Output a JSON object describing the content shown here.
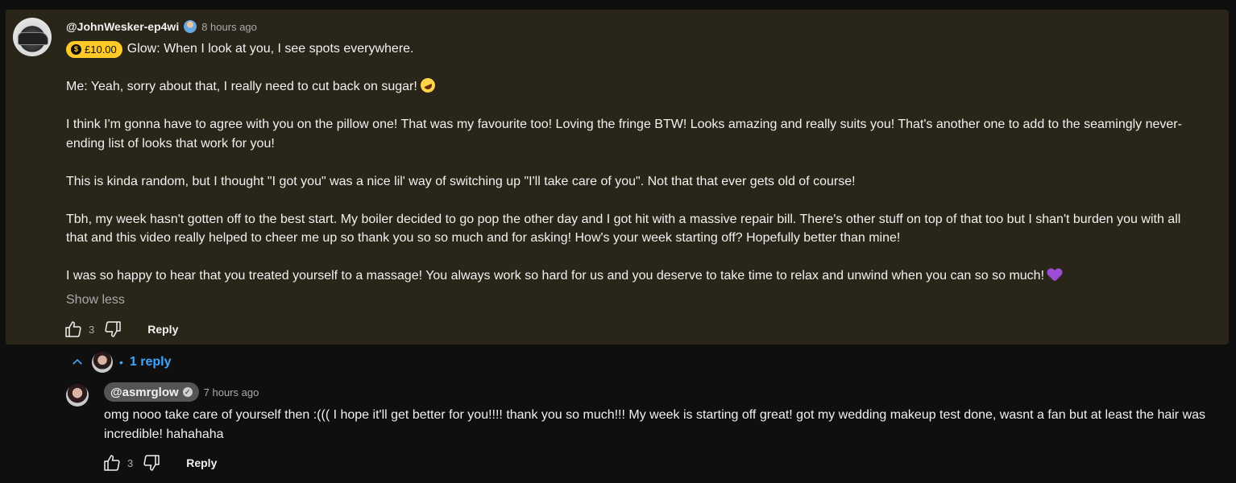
{
  "comment": {
    "author": "@JohnWesker-ep4wi",
    "member_badge_icon": "member-badge-icon",
    "time": "8 hours ago",
    "superthanks_amount": "£10.00",
    "paragraphs": [
      "Glow: When I look at you, I see spots everywhere.",
      "Me: Yeah, sorry about that, I really need to cut back on sugar!",
      "I think I'm gonna have to agree with you on the pillow one! That was my favourite too! Loving the fringe BTW! Looks amazing and really suits you! That's another one to add to the seamingly never-ending list of looks that work for you!",
      "This is kinda random, but I thought \"I got you\" was a nice lil' way of switching up \"I'll take care of you\". Not that that ever gets old of course!",
      "Tbh, my week hasn't gotten off to the best start. My boiler decided to go pop the other day and I got hit with a massive repair bill. There's other stuff on top of that too but I shan't burden you with all that and this video really helped to cheer me up so thank you so so much and for asking! How's your week starting off? Hopefully better than mine!",
      "I was so happy to hear that you treated yourself to a massage! You always work so hard for us and you deserve to take time to relax and unwind when you can so so much!"
    ],
    "show_less": "Show less",
    "like_count": "3",
    "reply_label": "Reply",
    "card_color": "#2a2519"
  },
  "replies_toggle": {
    "separator": "•",
    "label": "1 reply",
    "accent": "#3ea6ff"
  },
  "reply": {
    "author": "@asmrglow",
    "time": "7 hours ago",
    "text": "omg nooo take care of yourself then :((( I hope it'll get better for you!!!! thank you so much!!! My week is starting off great! got my wedding makeup test done, wasnt a fan but at least the hair was incredible! hahahaha",
    "like_count": "3",
    "reply_label": "Reply"
  }
}
